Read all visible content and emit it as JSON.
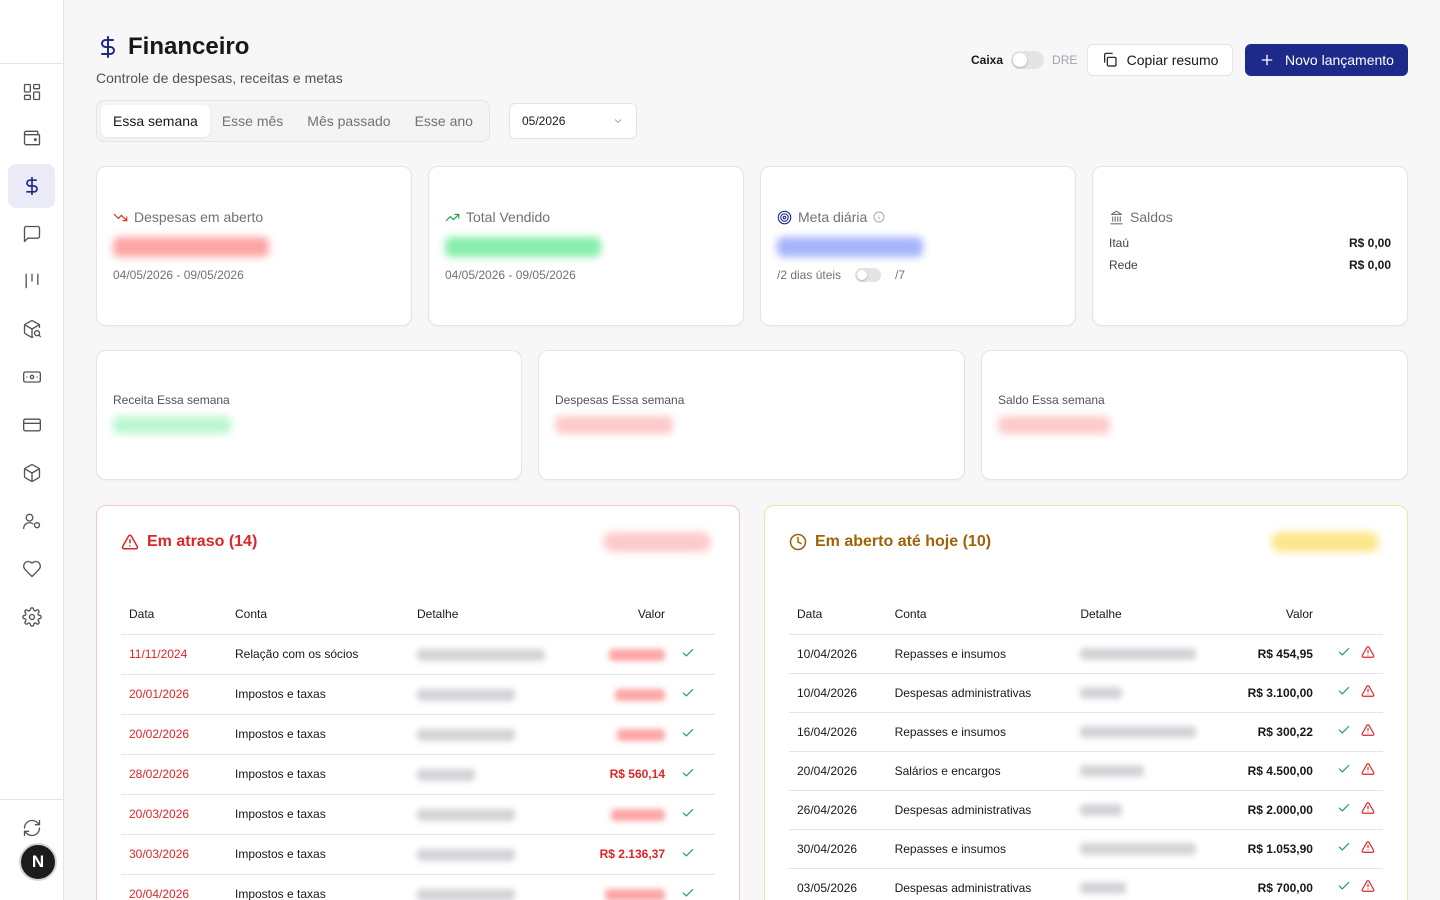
{
  "header": {
    "title": "Financeiro",
    "subtitle": "Controle de despesas, receitas e metas",
    "toggle_left": "Caixa",
    "toggle_right": "DRE",
    "copy_label": "Copiar resumo",
    "new_label": "Novo lançamento"
  },
  "tabs": [
    {
      "label": "Essa semana",
      "active": true
    },
    {
      "label": "Esse mês",
      "active": false
    },
    {
      "label": "Mês passado",
      "active": false
    },
    {
      "label": "Esse ano",
      "active": false
    }
  ],
  "month_select": "05/2026",
  "cards": {
    "despesas": {
      "label": "Despesas em aberto",
      "range": "04/05/2026 - 09/05/2026"
    },
    "vendido": {
      "label": "Total Vendido",
      "range": "04/05/2026 - 09/05/2026"
    },
    "meta": {
      "label": "Meta diária",
      "days_label": "/2 dias úteis",
      "days_total": "/7"
    },
    "saldos": {
      "label": "Saldos",
      "accounts": [
        {
          "name": "Itaú",
          "value": "R$ 0,00"
        },
        {
          "name": "Rede",
          "value": "R$ 0,00"
        }
      ]
    }
  },
  "summary": {
    "receita": "Receita Essa semana",
    "despesas": "Despesas Essa semana",
    "saldo": "Saldo Essa semana"
  },
  "overdue": {
    "title": "Em atraso (14)",
    "columns": [
      "Data",
      "Conta",
      "Detalhe",
      "Valor"
    ],
    "rows": [
      {
        "date": "11/11/2024",
        "account": "Relação com os sócios",
        "value": ""
      },
      {
        "date": "20/01/2026",
        "account": "Impostos e taxas",
        "value": ""
      },
      {
        "date": "20/02/2026",
        "account": "Impostos e taxas",
        "value": ""
      },
      {
        "date": "28/02/2026",
        "account": "Impostos e taxas",
        "value": "R$ 560,14"
      },
      {
        "date": "20/03/2026",
        "account": "Impostos e taxas",
        "value": ""
      },
      {
        "date": "30/03/2026",
        "account": "Impostos e taxas",
        "value": "R$ 2.136,37"
      },
      {
        "date": "20/04/2026",
        "account": "Impostos e taxas",
        "value": ""
      }
    ]
  },
  "open": {
    "title": "Em aberto até hoje (10)",
    "columns": [
      "Data",
      "Conta",
      "Detalhe",
      "Valor"
    ],
    "rows": [
      {
        "date": "10/04/2026",
        "account": "Repasses e insumos",
        "value": "R$ 454,95"
      },
      {
        "date": "10/04/2026",
        "account": "Despesas administrativas",
        "value": "R$ 3.100,00"
      },
      {
        "date": "16/04/2026",
        "account": "Repasses e insumos",
        "value": "R$ 300,22"
      },
      {
        "date": "20/04/2026",
        "account": "Salários e encargos",
        "value": "R$ 4.500,00"
      },
      {
        "date": "26/04/2026",
        "account": "Despesas administrativas",
        "value": "R$ 2.000,00"
      },
      {
        "date": "30/04/2026",
        "account": "Repasses e insumos",
        "value": "R$ 1.053,90"
      },
      {
        "date": "03/05/2026",
        "account": "Despesas administrativas",
        "value": "R$ 700,00"
      }
    ]
  },
  "avatar": "N",
  "colors": {
    "primary": "#1e2a8a",
    "danger": "#dc2626",
    "warning": "#a16207",
    "success": "#16a34a"
  }
}
